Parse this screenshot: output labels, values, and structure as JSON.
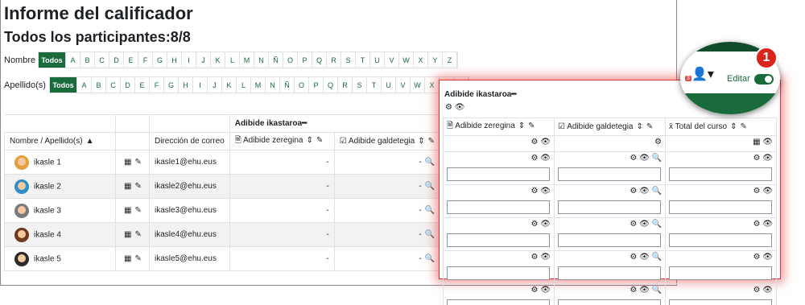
{
  "header": {
    "title": "Informe del calificador",
    "participants": "Todos los participantes:8/8"
  },
  "filters": {
    "first_name_label": "Nombre",
    "last_name_label": "Apellido(s)",
    "all_label": "Todos",
    "letters": [
      "A",
      "B",
      "C",
      "D",
      "E",
      "F",
      "G",
      "H",
      "I",
      "J",
      "K",
      "L",
      "M",
      "N",
      "Ñ",
      "O",
      "P",
      "Q",
      "R",
      "S",
      "T",
      "U",
      "V",
      "W",
      "X",
      "Y",
      "Z"
    ]
  },
  "grader": {
    "category": "Adibide ikastaroa",
    "col_name": "Nombre / Apellido(s)",
    "col_email": "Dirección de correo",
    "col_item1": "Adibide zeregina",
    "col_item2": "Adibide galdetegia",
    "rows": [
      {
        "name": "ikasle 1",
        "email": "ikasle1@ehu.eus",
        "grade1": "-",
        "grade2": "-"
      },
      {
        "name": "ikasle 2",
        "email": "ikasle2@ehu.eus",
        "grade1": "-",
        "grade2": "-"
      },
      {
        "name": "ikasle 3",
        "email": "ikasle3@ehu.eus",
        "grade1": "-",
        "grade2": "-"
      },
      {
        "name": "ikasle 4",
        "email": "ikasle4@ehu.eus",
        "grade1": "-",
        "grade2": "-"
      },
      {
        "name": "ikasle 5",
        "email": "ikasle5@ehu.eus",
        "grade1": "-",
        "grade2": "-"
      }
    ]
  },
  "edit_panel": {
    "category": "Adibide ikastaroa",
    "col_item1": "Adibide zeregina",
    "col_item2": "Adibide galdetegia",
    "col_total": "Total del curso",
    "total_symbol": "x̄"
  },
  "magnifier": {
    "notification_count": "3",
    "edit_label": "Editar",
    "step_number": "1"
  },
  "colors": {
    "accent": "#1a6b3c",
    "highlight": "#d9251c"
  }
}
